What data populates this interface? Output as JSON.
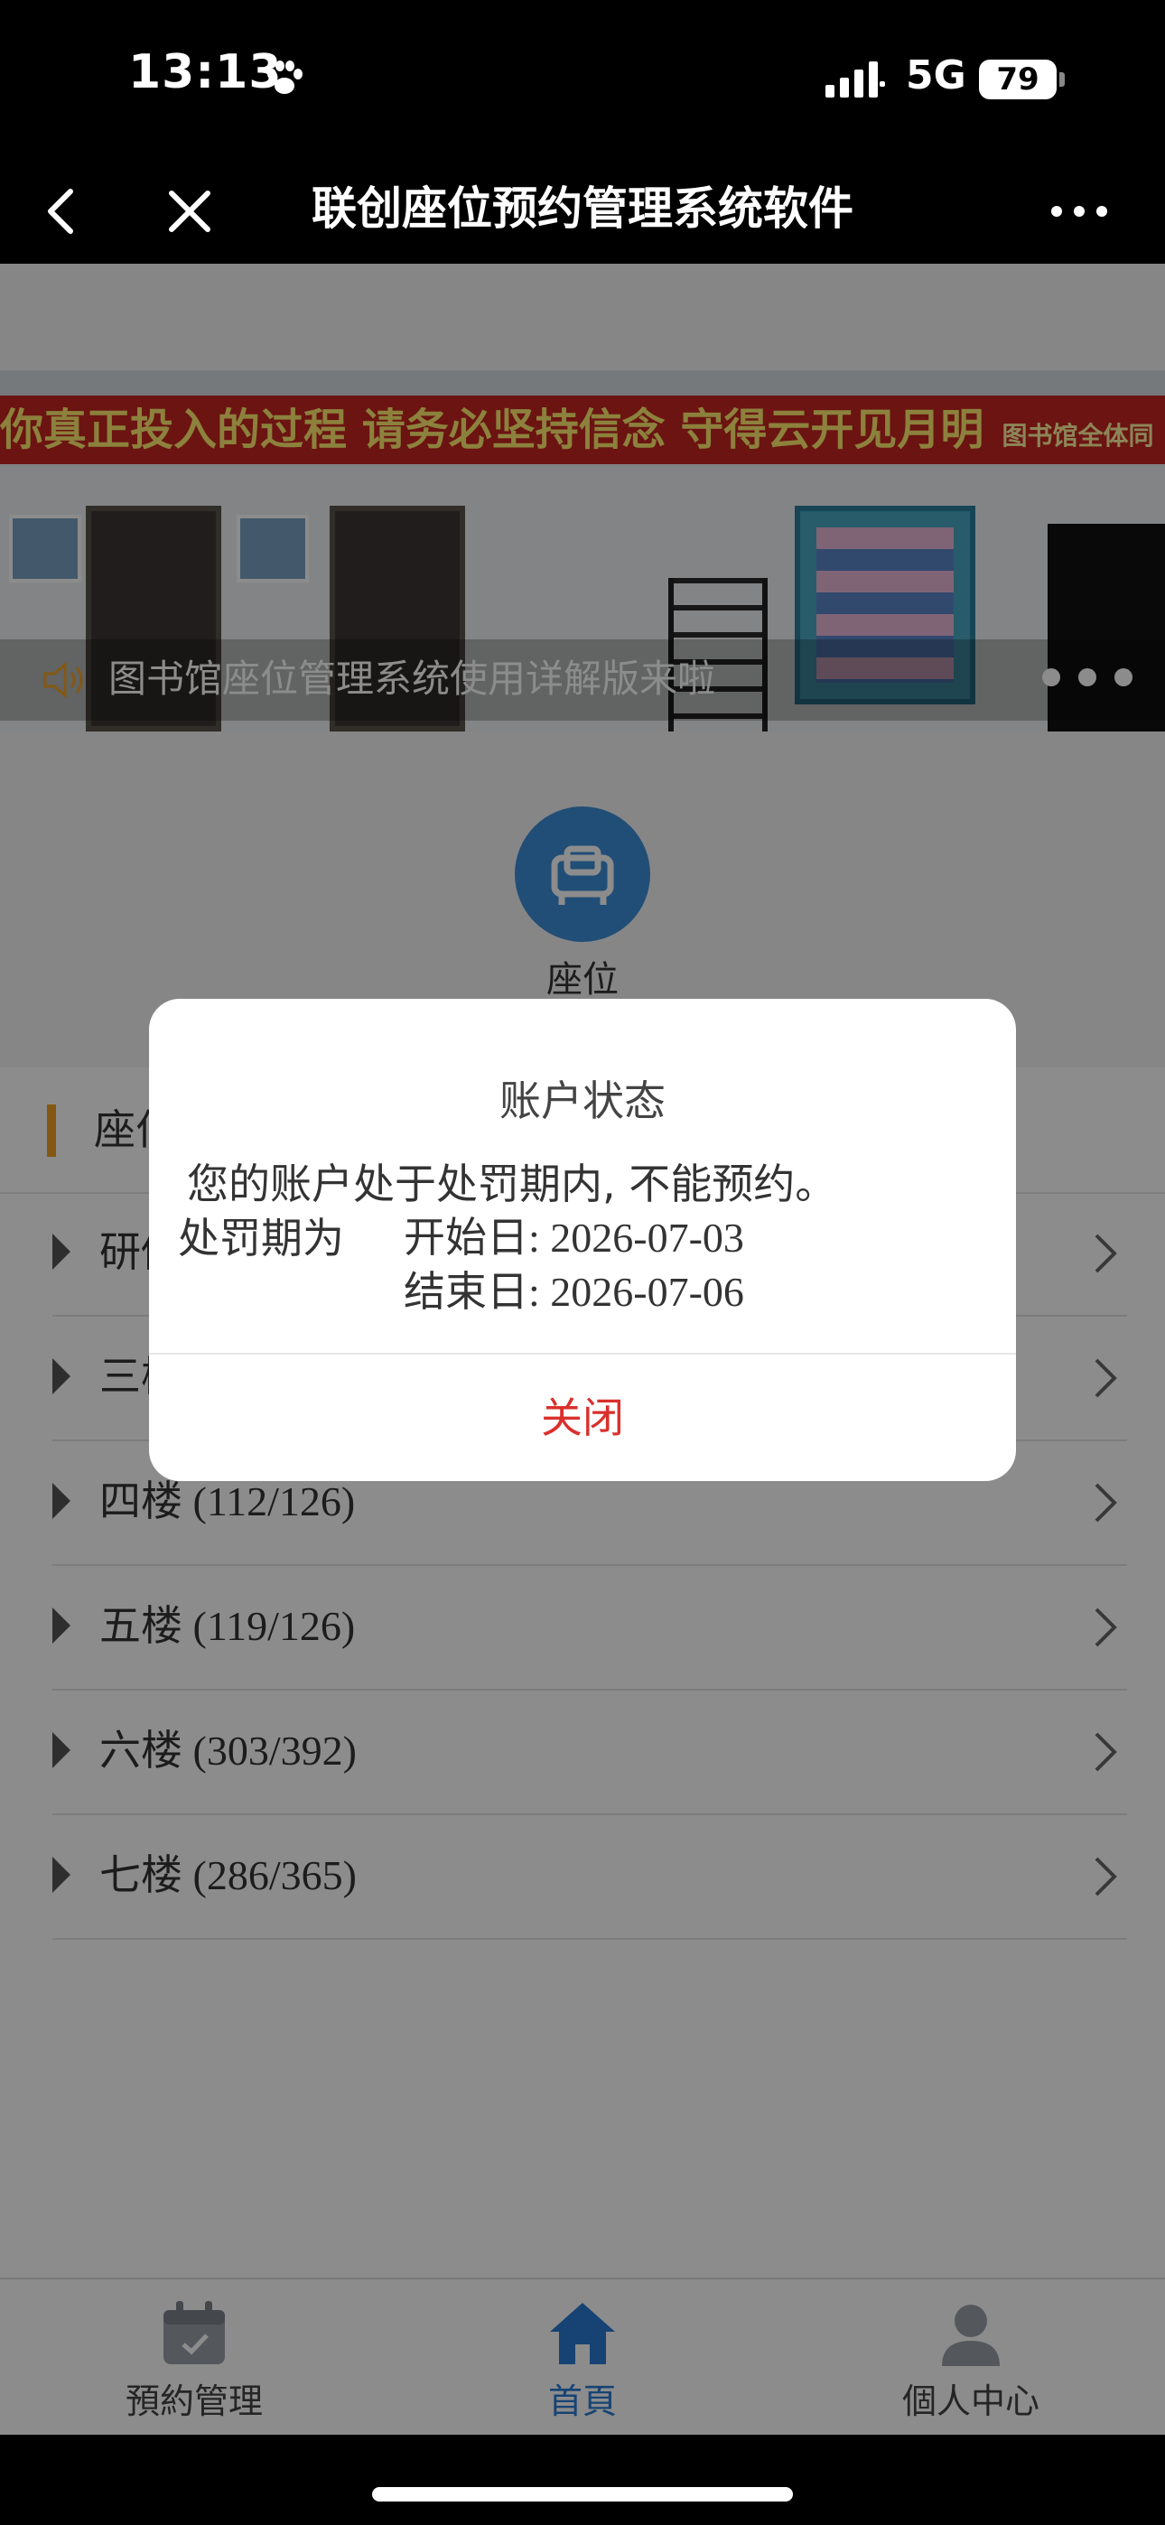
{
  "status_bar": {
    "time": "13:13",
    "network": "5G",
    "battery": "79"
  },
  "nav": {
    "title": "联创座位预约管理系统软件"
  },
  "banner": {
    "slogan": "你真正投入的过程 请务必坚持信念 守得云开见月明",
    "signature": "图书馆全体同",
    "notice": "图书馆座位管理系统使用详解版来啦"
  },
  "quick_entry": {
    "seat_label": "座位"
  },
  "section": {
    "title": "座位"
  },
  "floors": [
    {
      "label": "研修"
    },
    {
      "label": "三楼"
    },
    {
      "label": "四楼 (112/126)"
    },
    {
      "label": "五楼 (119/126)"
    },
    {
      "label": "六楼 (303/392)"
    },
    {
      "label": "七楼 (286/365)"
    }
  ],
  "tabs": [
    {
      "label": "預約管理",
      "icon": "calendar-icon"
    },
    {
      "label": "首頁",
      "icon": "home-icon"
    },
    {
      "label": "個人中心",
      "icon": "user-icon"
    }
  ],
  "dialog": {
    "title": "账户状态",
    "message": "您的账户处于处罚期内, 不能预约。",
    "period_label": "处罚期为",
    "start": "开始日: 2026-07-03",
    "end": "结束日: 2026-07-06",
    "close_label": "关闭"
  },
  "colors": {
    "accent": "#3d8fd8",
    "close_text": "#d9302c",
    "section_bar": "#f0a024"
  }
}
